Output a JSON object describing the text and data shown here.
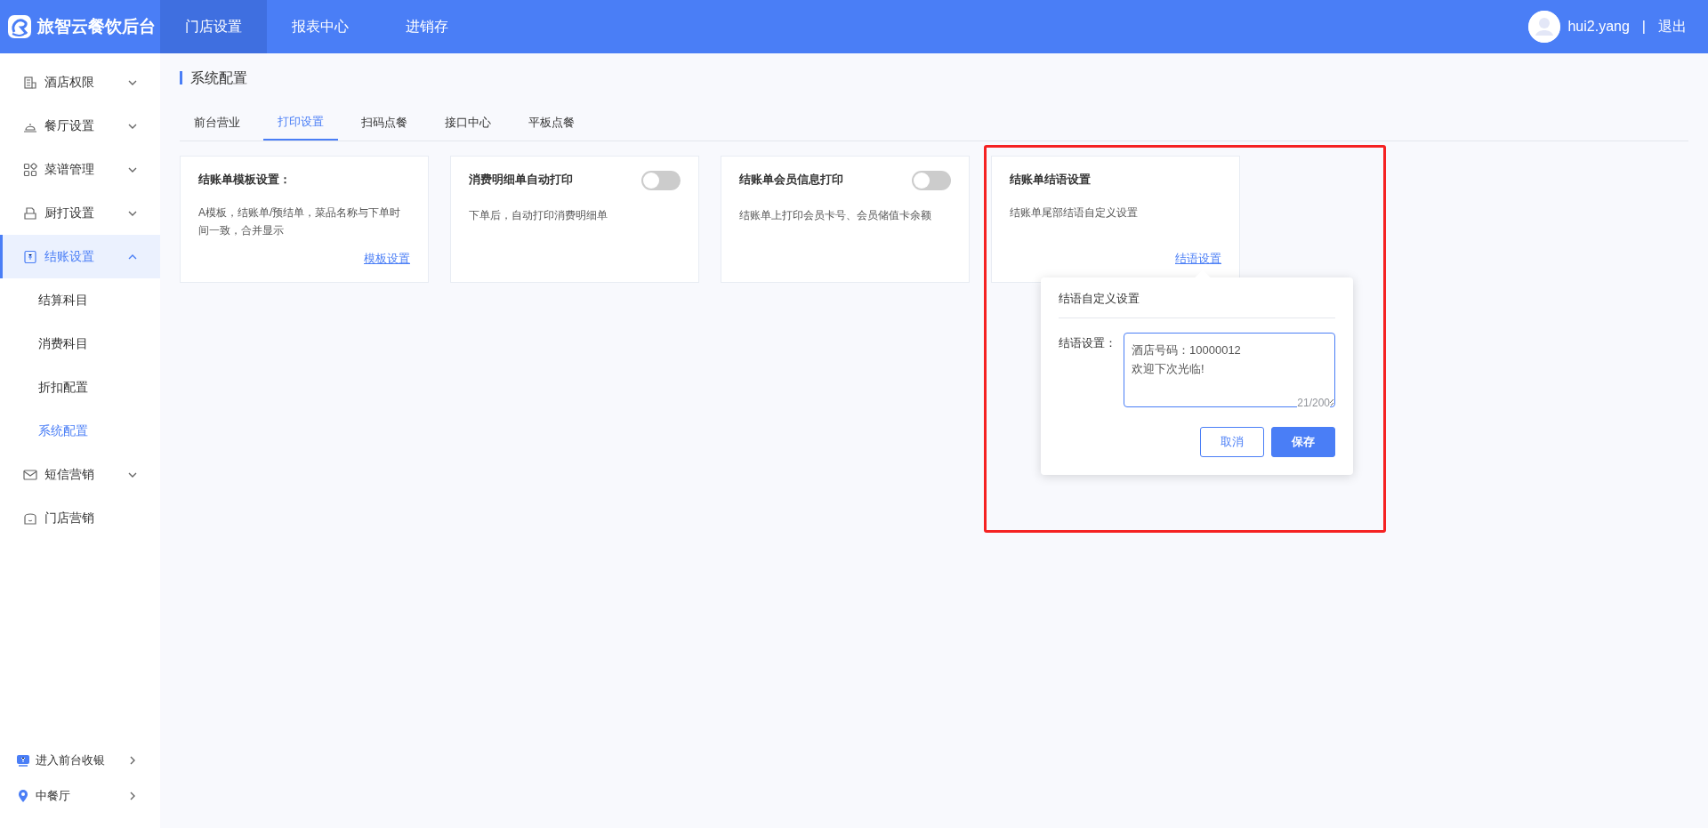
{
  "header": {
    "logo_text": "旅智云餐饮后台",
    "nav": [
      {
        "label": "门店设置",
        "selected": true
      },
      {
        "label": "报表中心",
        "selected": false
      },
      {
        "label": "进销存",
        "selected": false
      }
    ],
    "user": "hui2.yang",
    "separator": "|",
    "logout": "退出"
  },
  "sidebar": {
    "items": [
      {
        "label": "酒店权限",
        "selected": false,
        "expanded": false
      },
      {
        "label": "餐厅设置",
        "selected": false,
        "expanded": false
      },
      {
        "label": "菜谱管理",
        "selected": false,
        "expanded": false
      },
      {
        "label": "厨打设置",
        "selected": false,
        "expanded": false
      },
      {
        "label": "结账设置",
        "selected": true,
        "expanded": true,
        "children": [
          {
            "label": "结算科目",
            "selected": false
          },
          {
            "label": "消费科目",
            "selected": false
          },
          {
            "label": "折扣配置",
            "selected": false
          },
          {
            "label": "系统配置",
            "selected": true
          }
        ]
      },
      {
        "label": "短信营销",
        "selected": false,
        "expanded": false
      },
      {
        "label": "门店营销",
        "selected": false
      }
    ],
    "footer": [
      {
        "label": "进入前台收银"
      },
      {
        "label": "中餐厅"
      }
    ]
  },
  "page_title": "系统配置",
  "tabs": [
    {
      "label": "前台营业",
      "selected": false
    },
    {
      "label": "打印设置",
      "selected": true
    },
    {
      "label": "扫码点餐",
      "selected": false
    },
    {
      "label": "接口中心",
      "selected": false
    },
    {
      "label": "平板点餐",
      "selected": false
    }
  ],
  "cards": [
    {
      "kind": "link",
      "title": "结账单模板设置：",
      "description": "A模板，结账单/预结单，菜品名称与下单时间一致，合并显示",
      "link": "模板设置"
    },
    {
      "kind": "toggle",
      "title": "消费明细单自动打印",
      "on": false,
      "description": "下单后，自动打印消费明细单"
    },
    {
      "kind": "toggle",
      "title": "结账单会员信息打印",
      "on": false,
      "description": "结账单上打印会员卡号、会员储值卡余额"
    },
    {
      "kind": "link",
      "title": "结账单结语设置",
      "description": "结账单尾部结语自定义设置",
      "link": "结语设置"
    }
  ],
  "popover": {
    "title": "结语自定义设置",
    "field_label": "结语设置：",
    "value": "酒店号码：10000012\n欢迎下次光临!",
    "counter": "21/200",
    "buttons": [
      {
        "label": "取消",
        "kind": "secondary"
      },
      {
        "label": "保存",
        "kind": "primary"
      }
    ]
  }
}
